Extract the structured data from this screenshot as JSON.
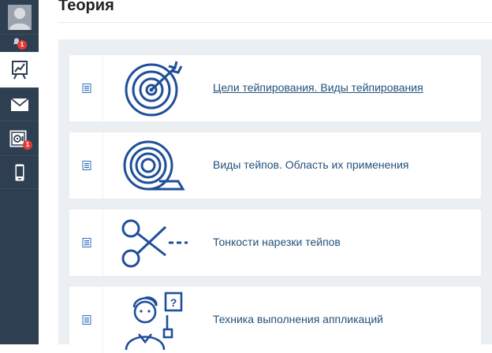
{
  "sidebar": {
    "items": [
      {
        "name": "avatar",
        "icon": "user-avatar-icon"
      },
      {
        "name": "notifications",
        "icon": "bell-icon",
        "badge": "1"
      },
      {
        "name": "progress",
        "icon": "chart-board-icon",
        "active": true
      },
      {
        "name": "messages",
        "icon": "envelope-icon"
      },
      {
        "name": "safe",
        "icon": "safe-icon",
        "badge": "1"
      },
      {
        "name": "mobile",
        "icon": "smartphone-icon"
      }
    ]
  },
  "page": {
    "title": "Теория"
  },
  "lessons": [
    {
      "title": "Цели тейпирования. Виды тейпирования",
      "icon": "target-arrow-icon",
      "doc_icon": "document-icon"
    },
    {
      "title": "Виды тейпов. Область их применения",
      "icon": "tape-roll-icon",
      "doc_icon": "document-icon"
    },
    {
      "title": "Тонкости нарезки тейпов",
      "icon": "scissors-icon",
      "doc_icon": "document-icon"
    },
    {
      "title": "Техника выполнения аппликаций",
      "icon": "teacher-question-icon",
      "doc_icon": "document-icon"
    }
  ],
  "colors": {
    "sidebar_bg": "#2f3f52",
    "content_bg": "#eceff1",
    "link": "#24527a",
    "icon_blue": "#1f4f9a",
    "badge": "#e53935"
  }
}
